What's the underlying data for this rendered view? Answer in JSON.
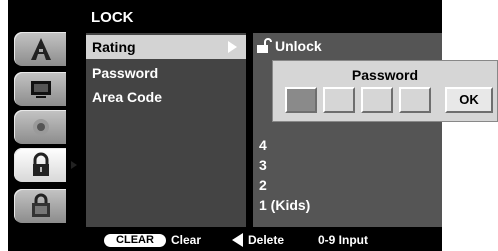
{
  "menu": {
    "title": "LOCK",
    "items": [
      {
        "label": "Rating"
      },
      {
        "label": "Password"
      },
      {
        "label": "Area Code"
      }
    ]
  },
  "options": {
    "items": [
      "Unlock",
      "4",
      "3",
      "2",
      "1 (Kids)"
    ]
  },
  "dialog": {
    "title": "Password",
    "ok_label": "OK"
  },
  "footer": {
    "clear_badge": "CLEAR",
    "clear_label": "Clear",
    "delete_label": "Delete",
    "input_label": "0-9 Input"
  },
  "icons": {
    "tabs": [
      "language-icon",
      "display-icon",
      "audio-icon",
      "lock-icon",
      "others-icon"
    ]
  }
}
